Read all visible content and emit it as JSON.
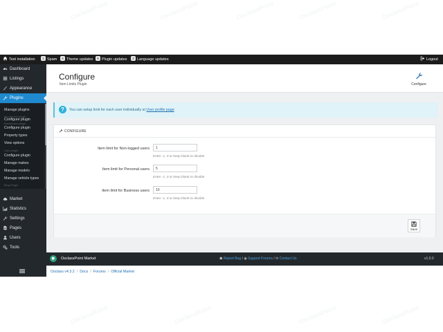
{
  "topbar": {
    "site_name": "Test installation",
    "spam": {
      "count": "1",
      "label": "Spam"
    },
    "theme_updates": {
      "count": "4",
      "label": "Theme updates"
    },
    "plugin_updates": {
      "count": "6",
      "label": "Plugin updates"
    },
    "language_updates": {
      "count": "2",
      "label": "Language updates"
    },
    "logout": "Logout"
  },
  "sidebar": {
    "items": [
      {
        "label": "Dashboard",
        "icon": "dashboard-icon"
      },
      {
        "label": "Listings",
        "icon": "list-icon"
      },
      {
        "label": "Appearance",
        "icon": "brush-icon"
      },
      {
        "label": "Plugins",
        "icon": "wrench-icon"
      },
      {
        "label": "Market",
        "icon": "cloud-icon"
      },
      {
        "label": "Statistics",
        "icon": "chart-icon"
      },
      {
        "label": "Settings",
        "icon": "wrench-icon"
      },
      {
        "label": "Pages",
        "icon": "file-icon"
      },
      {
        "label": "Users",
        "icon": "user-icon"
      },
      {
        "label": "Tools",
        "icon": "cogs-icon"
      }
    ],
    "submenu": [
      {
        "label": "Manage plugins",
        "faint": false
      },
      {
        "label": "Rovoleuive plugin",
        "faint": true
      },
      {
        "label": "Configure plugin",
        "faint": false
      },
      {
        "label": "Rovoleuive plugin",
        "faint": true
      },
      {
        "label": "Configure plugin",
        "faint": false
      },
      {
        "label": "Property types",
        "faint": false
      },
      {
        "label": "View options",
        "faint": false
      },
      {
        "label": "Cars plugin",
        "faint": true
      },
      {
        "label": "Configure plugin",
        "faint": false
      },
      {
        "label": "Manage makes",
        "faint": false
      },
      {
        "label": "Manage models",
        "faint": false
      },
      {
        "label": "Manage vehicle types",
        "faint": false
      },
      {
        "label": "Blog Plugin",
        "faint": true
      }
    ]
  },
  "header": {
    "title": "Configure",
    "subtitle": "Item Limits Plugin",
    "configure_label": "Configure"
  },
  "info": {
    "text": "You can setup limit for each user individually at",
    "link": "User profile page"
  },
  "panel": {
    "title": "CONFIGURE",
    "rows": [
      {
        "label": "Item limit for Non-logged users",
        "value": "1",
        "help": "Enter -1, 0 or keep blank to disable"
      },
      {
        "label": "Item limit for Personal users",
        "value": "5",
        "help": "Enter -1, 0 or keep blank to disable"
      },
      {
        "label": "Item limit for Business users",
        "value": "10",
        "help": "Enter -1, 0 or keep blank to disable"
      }
    ],
    "save_label": "Save"
  },
  "footer": {
    "brand": "OsclassPoint Market",
    "links": [
      "Report Bug",
      "Support Forums",
      "Contact Us"
    ],
    "separator": "/",
    "version": "v1.0.0"
  },
  "breadcrumbs": [
    "Osclass v4.3.2",
    "Docs",
    "Forums",
    "Official Market"
  ],
  "watermark": "OsclassPoint",
  "colors": {
    "accent": "#1f8ad0",
    "sidebar": "#23282d",
    "topbar": "#1c1c1c",
    "info_bg": "#dff3f8"
  }
}
